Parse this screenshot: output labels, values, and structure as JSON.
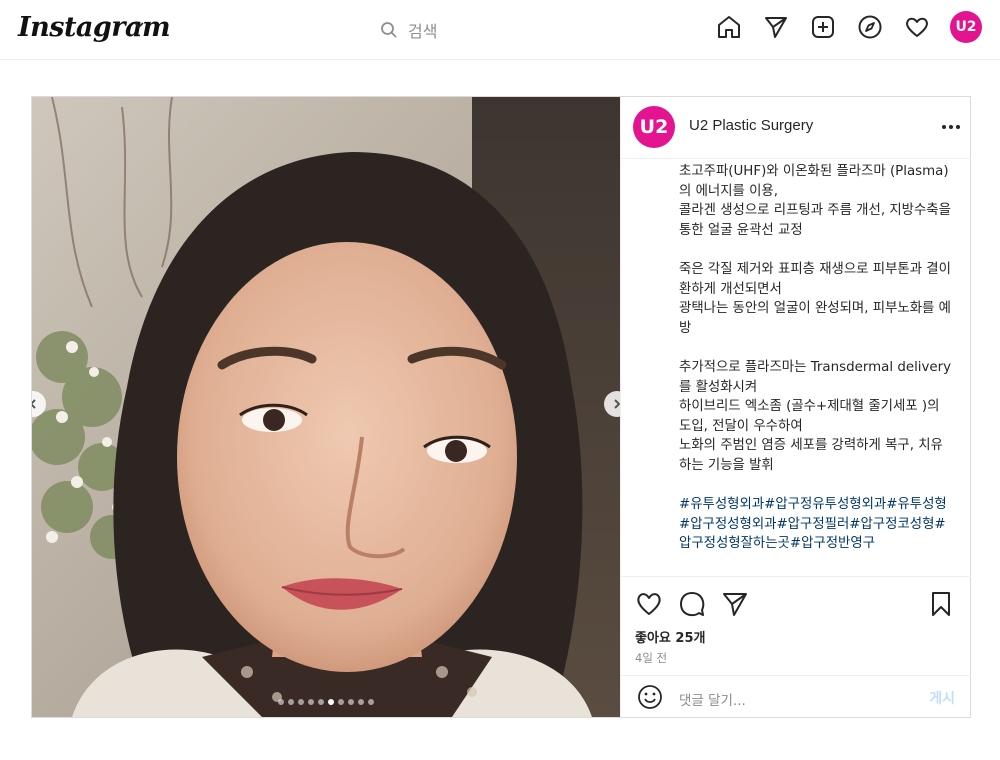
{
  "header": {
    "logo": "Instagram",
    "search_placeholder": "검색",
    "profile_initials": "U2"
  },
  "post": {
    "account_name": "U2 Plastic Surgery",
    "avatar_initials": "U2",
    "caption": [
      "초고주파(UHF)와 이온화된 플라즈마 (Plasma)의 에너지를 이용,\n콜라겐 생성으로 리프팅과 주름 개선, 지방수축을 통한 얼굴 윤곽선 교정",
      "죽은 각질 제거와 표피층 재생으로 피부톤과 결이 환하게 개선되면서\n광택나는 동안의 얼굴이 완성되며, 피부노화를 예방",
      "추가적으로 플라즈마는 Transdermal delivery를 활성화시켜\n하이브리드 엑소좀 (골수+제대혈 줄기세포 )의 도입, 전달이 우수하여\n노화의 주범인 염증 세포를 강력하게 복구, 치유하는 기능을 발휘"
    ],
    "hashtags": "#유투성형외과#압구정유투성형외과#유투성형#압구정성형외과#압구정필러#압구정코성형#압구정성형잘하는곳#압구정반영구",
    "likes": "좋아요 25개",
    "time": "4일 전",
    "comment_placeholder": "댓글 달기...",
    "post_button": "게시",
    "carousel": {
      "total": 10,
      "active_index": 5
    }
  },
  "colors": {
    "brand": "#e4138f",
    "link": "#00376b",
    "muted": "#8e8e8e"
  },
  "icons": [
    "instagram-logo",
    "chevron-down-icon",
    "search-icon",
    "home-icon",
    "direct-icon",
    "create-icon",
    "explore-icon",
    "heart-icon",
    "more-icon",
    "like-icon",
    "comment-icon",
    "share-icon",
    "save-icon",
    "emoji-icon",
    "prev-icon",
    "next-icon"
  ]
}
